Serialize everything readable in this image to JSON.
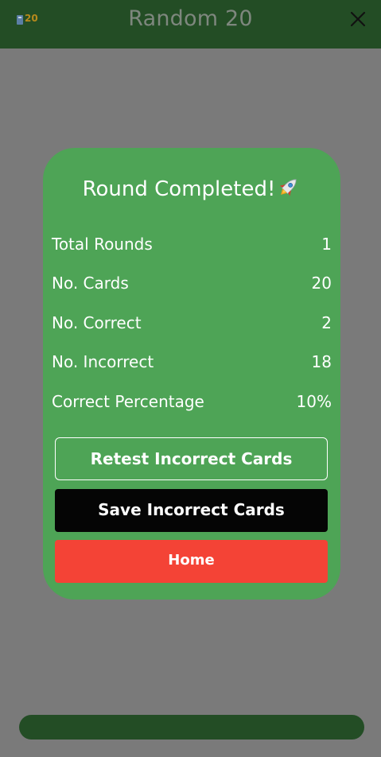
{
  "header": {
    "title": "Random 20",
    "app_icon": "flashcard-20-icon",
    "app_icon_text": "20",
    "close_icon": "close-icon"
  },
  "dialog": {
    "title": "Round Completed!",
    "title_icon": "rocket-icon",
    "stats": [
      {
        "label": "Total Rounds",
        "value": "1"
      },
      {
        "label": "No. Cards",
        "value": "20"
      },
      {
        "label": "No. Correct",
        "value": "2"
      },
      {
        "label": "No. Incorrect",
        "value": "18"
      },
      {
        "label": "Correct Percentage",
        "value": "10%"
      }
    ],
    "buttons": {
      "retest": "Retest Incorrect Cards",
      "save": "Save Incorrect Cards",
      "home": "Home"
    }
  },
  "colors": {
    "header_bg": "#234d25",
    "overlay_bg": "#7a7a7a",
    "dialog_bg": "#4ea456",
    "save_button_bg": "#050505",
    "home_button_bg": "#f44336"
  }
}
